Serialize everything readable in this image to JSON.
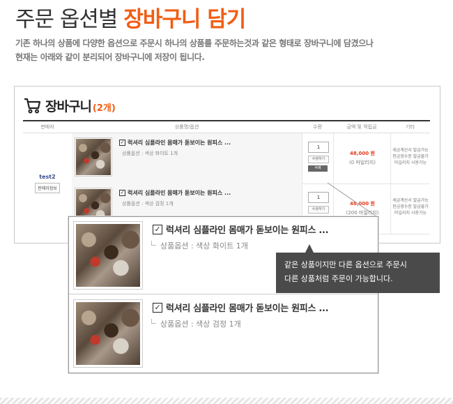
{
  "heading": {
    "plain": "주문 옵션별",
    "accent": "장바구니 담기"
  },
  "description": {
    "line1": "기존 하나의 상품에 다양한 옵션으로 주문시 하나의 상품를 주문하는것과 같은 형태로 장바구니에 담겼으나",
    "line2": "현재는 아래와 같이 분리되어 장바구니에 저장이 됩니다."
  },
  "cart": {
    "title": "장바구니",
    "count": "(2개)",
    "columns": [
      "판매자",
      "상품명/옵션",
      "수량",
      "금액 및 적립금",
      "기타"
    ],
    "seller": {
      "name": "test2",
      "info_button": "판매자정보"
    },
    "items": [
      {
        "name": "럭셔리 심플라인 몸매가 돋보이는 원피스 ...",
        "option": "상품옵션 : 색상 화이트 1개",
        "qty": "1",
        "modify_label": "수정하기",
        "delete_label": "삭제",
        "price": "48,000 원",
        "mileage": "(0 마일리지)",
        "etc": [
          "세금계산서 발급가능",
          "현금영수증 발급불가",
          "마일리지 사용가능"
        ]
      },
      {
        "name": "럭셔리 심플라인 몸매가 돋보이는 원피스 ...",
        "option": "상품옵션 : 색상 검정 1개",
        "qty": "1",
        "modify_label": "수정하기",
        "price": "48,000 원",
        "mileage": "(200 마일리지)",
        "etc": [
          "세금계산서 발급가능",
          "현금영수증 발급불가",
          "마일리지 사용가능"
        ]
      }
    ]
  },
  "zoom": {
    "items": [
      {
        "name": "럭셔리 심플라인 몸매가 돋보이는 원피스 ...",
        "option": "상품옵션 : 색상 화이트 1개"
      },
      {
        "name": "럭셔리 심플라인 몸매가 돋보이는 원피스 ...",
        "option": "상품옵션 : 색상 검정 1개"
      }
    ]
  },
  "tooltip": {
    "line1": "같은 상품이지만 다른 옵션으로 주문시",
    "line2": "다른 상품처럼 주문이 가능합니다."
  },
  "colors": {
    "accent": "#f25d14",
    "price": "#e53a1e",
    "tooltip_bg": "#4a4a4a"
  },
  "icons": {
    "cart": "shopping-cart-icon",
    "check": "checkbox-checked-icon"
  }
}
